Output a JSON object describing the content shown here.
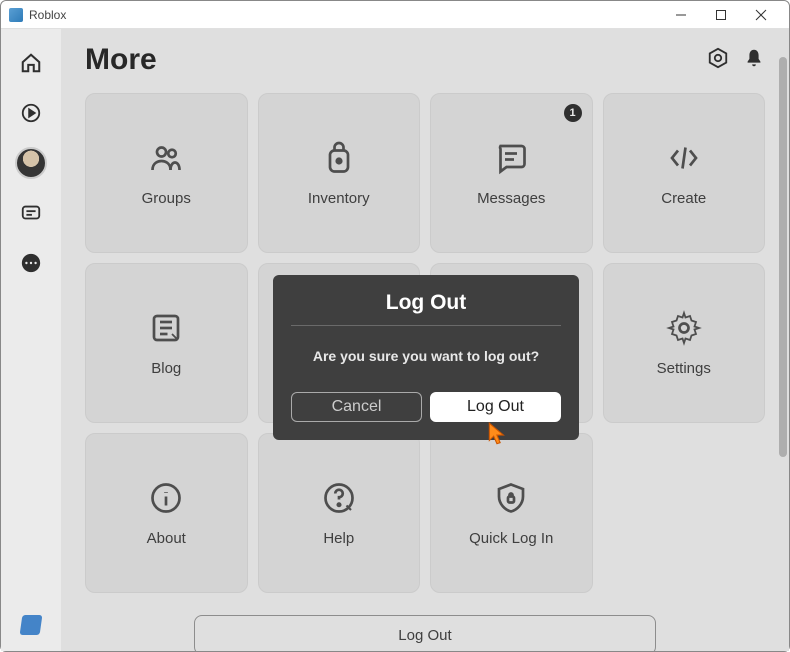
{
  "window": {
    "title": "Roblox"
  },
  "page": {
    "title": "More"
  },
  "tiles": [
    {
      "label": "Groups",
      "badge": null
    },
    {
      "label": "Inventory",
      "badge": null
    },
    {
      "label": "Messages",
      "badge": "1"
    },
    {
      "label": "Create",
      "badge": null
    },
    {
      "label": "Blog",
      "badge": null
    },
    {
      "label": "",
      "badge": null
    },
    {
      "label": "",
      "badge": null
    },
    {
      "label": "Settings",
      "badge": null
    },
    {
      "label": "About",
      "badge": null
    },
    {
      "label": "Help",
      "badge": null
    },
    {
      "label": "Quick Log In",
      "badge": null
    }
  ],
  "logout_button": "Log Out",
  "modal": {
    "title": "Log Out",
    "message": "Are you sure you want to log out?",
    "cancel": "Cancel",
    "confirm": "Log Out"
  }
}
